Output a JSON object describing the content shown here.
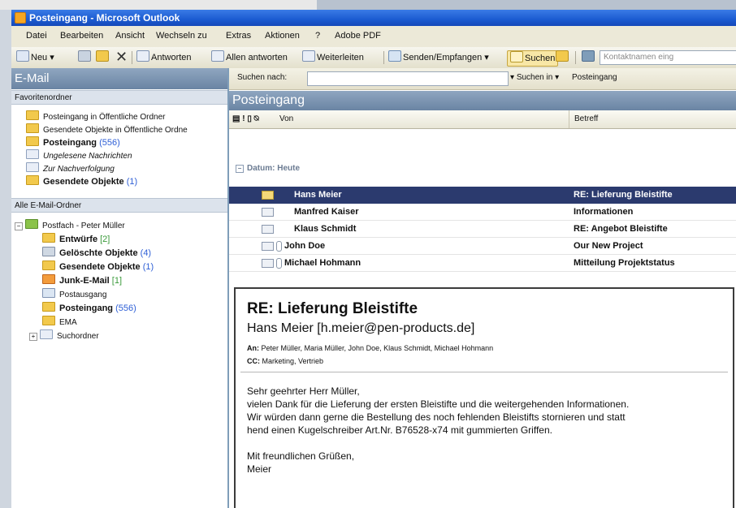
{
  "window": {
    "title": "Posteingang - Microsoft Outlook"
  },
  "menu": [
    "Datei",
    "Bearbeiten",
    "Ansicht",
    "Wechseln zu",
    "Extras",
    "Aktionen",
    "?",
    "Adobe PDF"
  ],
  "toolbar": {
    "new": "Neu",
    "reply": "Antworten",
    "reply_all": "Allen antworten",
    "forward": "Weiterleiten",
    "send_receive": "Senden/Empfangen",
    "search": "Suchen",
    "contact_placeholder": "Kontaktnamen eing"
  },
  "nav": {
    "header": "E-Mail",
    "favorites_header": "Favoritenordner",
    "favorites": [
      {
        "label": "Posteingang in Öffentliche Ordner",
        "count": ""
      },
      {
        "label": "Gesendete Objekte in Öffentliche Ordne",
        "count": ""
      },
      {
        "label": "Posteingang",
        "count": "(556)"
      },
      {
        "label": "Ungelesene Nachrichten",
        "count": ""
      },
      {
        "label": "Zur Nachverfolgung",
        "count": ""
      },
      {
        "label": "Gesendete Objekte",
        "count": "(1)"
      }
    ],
    "all_header": "Alle E-Mail-Ordner",
    "mailbox": "Postfach - Peter Müller",
    "folders": [
      {
        "label": "Entwürfe",
        "count": "[2]"
      },
      {
        "label": "Gelöschte Objekte",
        "count": "(4)"
      },
      {
        "label": "Gesendete Objekte",
        "count": "(1)"
      },
      {
        "label": "Junk-E-Mail",
        "count": "[1]"
      },
      {
        "label": "Postausgang",
        "count": ""
      },
      {
        "label": "Posteingang",
        "count": "(556)"
      },
      {
        "label": "EMA",
        "count": ""
      },
      {
        "label": "Suchordner",
        "count": ""
      }
    ]
  },
  "search": {
    "label": "Suchen nach:",
    "search_in": "Suchen in",
    "search_in_value": "Posteingang"
  },
  "list": {
    "title": "Posteingang",
    "col_from": "Von",
    "col_subject": "Betreff",
    "group": "Datum: Heute",
    "rows": [
      {
        "from": "Hans Meier",
        "subject": "RE: Lieferung Bleistifte"
      },
      {
        "from": "Manfred Kaiser",
        "subject": "Informationen"
      },
      {
        "from": "Klaus Schmidt",
        "subject": "RE: Angebot Bleistifte"
      },
      {
        "from": "John Doe",
        "subject": "Our New Project"
      },
      {
        "from": "Michael Hohmann",
        "subject": "Mitteilung Projektstatus"
      }
    ]
  },
  "preview": {
    "subject": "RE: Lieferung Bleistifte",
    "sender": "Hans Meier [h.meier@pen-products.de]",
    "to_label": "An:",
    "to": "Peter Müller, Maria Müller, John Doe, Klaus Schmidt, Michael Hohmann",
    "cc_label": "CC:",
    "cc": "Marketing, Vertrieb",
    "body": [
      "Sehr geehrter Herr Müller,",
      "vielen Dank für die Lieferung der ersten Bleistifte und die weitergehenden Informationen.",
      "Wir würden dann gerne die Bestellung des noch fehlenden Bleistifts stornieren und statt",
      "hend einen Kugelschreiber Art.Nr. B76528-x74 mit gummierten Griffen.",
      "",
      "Mit freundlichen Grüßen,",
      "Meier"
    ]
  },
  "colors": {
    "selection": "#2b3a6e",
    "pane_header": "#6a84a3",
    "count_blue": "#2e5fd6",
    "count_green": "#3a9a3a"
  }
}
